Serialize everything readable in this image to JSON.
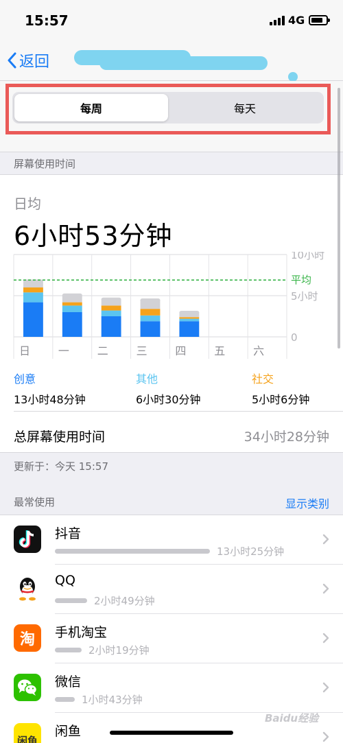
{
  "status_bar": {
    "time": "15:57",
    "network": "4G",
    "battery_level": 0.8
  },
  "nav": {
    "back_label": "返回"
  },
  "segments": {
    "weekly": "每周",
    "daily": "每天"
  },
  "section_title": "屏幕使用时间",
  "daily_average": {
    "label": "日均",
    "value": "6小时53分钟"
  },
  "chart_data": {
    "type": "bar",
    "stacked": true,
    "categories": [
      "日",
      "一",
      "二",
      "三",
      "四",
      "五",
      "六"
    ],
    "series": [
      {
        "name": "创意",
        "color": "#1a7cf5",
        "values": [
          4.2,
          3.0,
          2.5,
          1.9,
          1.9,
          0,
          0
        ]
      },
      {
        "name": "其他",
        "color": "#5bc4f0",
        "values": [
          1.2,
          0.8,
          0.7,
          0.7,
          0.3,
          0,
          0
        ]
      },
      {
        "name": "社交",
        "color": "#f5a21b",
        "values": [
          0.6,
          0.4,
          0.6,
          0.8,
          0.2,
          0,
          0
        ]
      },
      {
        "color": "#d2d2d6",
        "values": [
          0.8,
          0.9,
          0.8,
          1.1,
          0.6,
          0,
          0
        ]
      }
    ],
    "y_ticks": [
      "10小时",
      "5小时",
      "0"
    ],
    "ylim": [
      0,
      10
    ],
    "average": {
      "label": "平均",
      "value": 6.9,
      "color": "#3ab54a"
    }
  },
  "categories_summary": [
    {
      "name": "创意",
      "value": "13小时48分钟",
      "color": "#1a7cf5"
    },
    {
      "name": "其他",
      "value": "6小时30分钟",
      "color": "#5bc4f0"
    },
    {
      "name": "社交",
      "value": "5小时6分钟",
      "color": "#f5a21b"
    }
  ],
  "total": {
    "label": "总屏幕使用时间",
    "value": "34小时28分钟"
  },
  "updated": "更新于：今天 15:57",
  "most_used": {
    "title": "最常使用",
    "action": "显示类别"
  },
  "apps": [
    {
      "name": "抖音",
      "time": "13小时25分钟",
      "usage": 13.42,
      "icon": "douyin-icon"
    },
    {
      "name": "QQ",
      "time": "2小时49分钟",
      "usage": 2.82,
      "icon": "qq-icon"
    },
    {
      "name": "手机淘宝",
      "time": "2小时19分钟",
      "usage": 2.32,
      "icon": "taobao-icon"
    },
    {
      "name": "微信",
      "time": "1小时43分钟",
      "usage": 1.72,
      "icon": "wechat-icon"
    },
    {
      "name": "闲鱼",
      "time": "",
      "usage": 0,
      "icon": "xianyu-icon"
    }
  ],
  "watermark": "Baidu经验"
}
